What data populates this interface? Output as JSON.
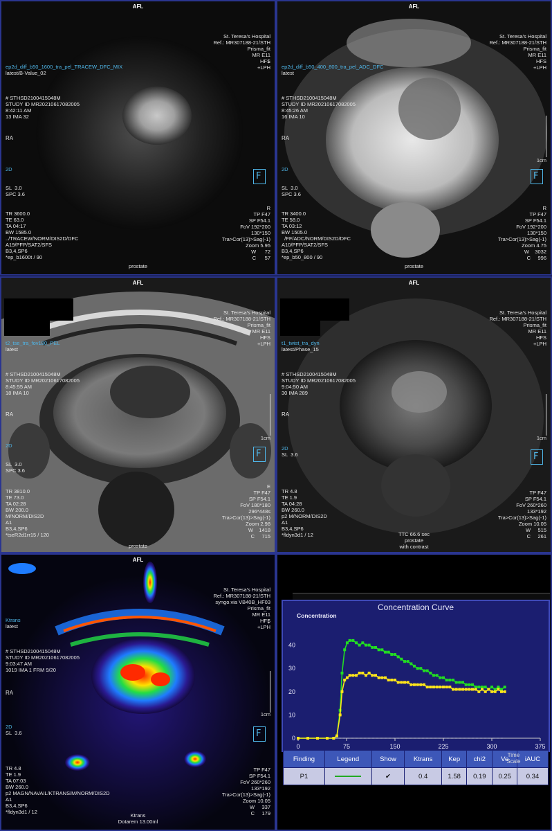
{
  "common": {
    "afl": "AFL",
    "ra": "RA",
    "cm": "1cm",
    "hospital": [
      "St. Teresa's Hospital",
      "Ref.: MR307188-21/STH",
      "Prisma_fit",
      "MR E11",
      "HFS",
      "+LPH"
    ]
  },
  "panels": [
    {
      "id": "p1",
      "series": "ep2d_diff_b50_1600_tra_pel_TRACEW_DFC_MIX",
      "sub": "latest/B-Value_02",
      "study": [
        "# STHSD2100415048M",
        "STUDY ID MR20210617082005",
        "8:42:11 AM",
        "13 IMA 32"
      ],
      "slice": [
        "2D",
        "SL  3.0",
        "SPC 3.6"
      ],
      "params": [
        "TR 3600.0",
        "TE 63.0",
        "TA 04:17",
        "BW 1585.0",
        "../TRACEW/NORM/DIS2D/DFC",
        "",
        "A19/PFP/SAT2/SFS",
        "B3,4,SP6",
        "*ep_b1600t / 90"
      ],
      "right": [
        "R",
        "TP F47",
        "SP F54.1",
        "FoV 192*200",
        "130*150",
        "Tra>Cor(13)>Sag(-1)",
        "Zoom 5.95",
        "W      72",
        "C      57"
      ],
      "bottom": [
        "prostate"
      ]
    },
    {
      "id": "p2",
      "series": "ep2d_diff_b50_400_800_tra_pel_ADC_DFC",
      "sub": "latest",
      "study": [
        "# STHSD2100415048M",
        "STUDY ID MR20210617082005",
        "8:45:26 AM",
        "16 IMA 10"
      ],
      "slice": [
        "2D",
        "SL  3.0",
        "SPC 3.6"
      ],
      "params": [
        "TR 3400.0",
        "TE 58.0",
        "TA 03:12",
        "BW 1505.0",
        "  /FF/ADC/NORM/DIS2D/DFC",
        "",
        "A10/PFP/SAT2/SFS",
        "B3,4,SP6",
        "*ep_b50_800 / 90"
      ],
      "right": [
        "R",
        "TP F47",
        "SP F54.1",
        "FoV 192*200",
        "130*150",
        "Tra>Cor(13)>Sag(-1)",
        "Zoom 4.75",
        "W    3032",
        "C     996"
      ],
      "bottom": [
        "prostate"
      ]
    },
    {
      "id": "p3",
      "series": "t2_tse_tra_fov180_PEL",
      "sub": "latest",
      "study": [
        "# STHSD2100415048M",
        "STUDY ID MR20210617082005",
        "8:45:55 AM",
        "18 IMA 10"
      ],
      "slice": [
        "2D",
        "SL  3.0",
        "SPC 3.6"
      ],
      "params": [
        "TR 3810.0",
        "TE 73.0",
        "TA 02:28",
        "BW 200.0",
        "M/NORM/DIS2D",
        "",
        "A1",
        "B3,4,SP6",
        "*tseR2d1rr15 / 120"
      ],
      "right": [
        "E",
        "TP F47",
        "SP F54.1",
        "FoV 180*180",
        "296*448s",
        "Tra>Cor(13)>Sag(-1)",
        "Zoom 2.98",
        "W    1418",
        "C     715"
      ],
      "bottom": [
        "prostate"
      ]
    },
    {
      "id": "p4",
      "series": "t1_twist_tra_dyn",
      "sub": "latest/Phase_15",
      "study": [
        "# STHSD2100415048M",
        "STUDY ID MR20210617082005",
        "9:04:50 AM",
        "30 IMA 289"
      ],
      "slice": [
        "2D",
        "SL  3.6"
      ],
      "params": [
        "TR 4.8",
        "TE 1.9",
        "TA 04:28",
        "BW 260.0",
        "p2 M/NORM/DIS2D",
        "",
        "A1",
        "B3,4,SP6",
        "*fldyn3d1 / 12"
      ],
      "right": [
        "TP F47",
        "SP F54.1",
        "FoV 260*260",
        "133*192",
        "Tra>Cor(13)>Sag(-1)",
        "Zoom 10.05",
        "W     515",
        "C     261"
      ],
      "bottom": [
        "TTC 66.6 sec",
        "prostate",
        "with contrast"
      ]
    },
    {
      "id": "p5",
      "series": "Ktrans",
      "sub": "latest",
      "study": [
        "# STHSD2100415048M",
        "STUDY ID MR20210617082005",
        "9:03:47 AM",
        "1019 IMA 1 FRM 9/20"
      ],
      "slice": [
        "2D",
        "SL  3.6"
      ],
      "params": [
        "TR 4.8",
        "TE 1.9",
        "TA 07:03",
        "BW 260.0",
        "p2 MAGN/NAVAIL/KTRANS/M/NORM/DIS2D",
        "",
        "A1",
        "B3,4,SP6",
        "*fldyn3d1 / 12"
      ],
      "right": [
        "TP F47",
        "SP F54.1",
        "FoV 260*260",
        "133*192",
        "Tra>Cor(13)>Sag(-1)",
        "Zoom 10.05",
        "W     337",
        "C     179"
      ],
      "bottom": [
        "Ktrans",
        "Dotarem 13.00ml"
      ],
      "extra": "syngo.via VB40B_HF03"
    }
  ],
  "chart_data": {
    "type": "line",
    "title": "Concentration Curve",
    "ylabel": "Concentration",
    "xlabel": "",
    "xlim": [
      0,
      375
    ],
    "ylim": [
      0,
      50
    ],
    "x_ticks": [
      0,
      75,
      150,
      225,
      300,
      375
    ],
    "y_ticks": [
      0,
      10,
      20,
      30,
      40
    ],
    "y_tick_labels": [
      "0",
      "10",
      "20",
      "30",
      "40"
    ],
    "colors": {
      "green": "#22dd22",
      "yellow": "#ffe61a",
      "baseline": "#dddddd"
    },
    "series": [
      {
        "color": "green",
        "x": [
          0,
          15,
          30,
          45,
          55,
          60,
          65,
          68,
          72,
          76,
          80,
          85,
          90,
          95,
          100,
          105,
          110,
          115,
          120,
          125,
          130,
          135,
          140,
          145,
          150,
          155,
          160,
          165,
          170,
          175,
          180,
          185,
          190,
          195,
          200,
          205,
          210,
          215,
          220,
          225,
          230,
          235,
          240,
          245,
          250,
          255,
          260,
          265,
          270,
          275,
          280,
          285,
          290,
          295,
          300,
          305,
          310,
          315,
          320
        ],
        "y": [
          0,
          0,
          0,
          0,
          0,
          1,
          12,
          28,
          38,
          41,
          42,
          42,
          41,
          40,
          41,
          40,
          40,
          39,
          39,
          38,
          38,
          37,
          37,
          36,
          36,
          35,
          34,
          33,
          33,
          32,
          31,
          30,
          30,
          29,
          29,
          28,
          27,
          27,
          26,
          26,
          25,
          25,
          25,
          24,
          24,
          24,
          23,
          23,
          23,
          22,
          22,
          22,
          22,
          21,
          22,
          21,
          22,
          21,
          22
        ]
      },
      {
        "color": "yellow",
        "x": [
          0,
          15,
          30,
          45,
          55,
          60,
          65,
          68,
          72,
          76,
          80,
          85,
          90,
          95,
          100,
          105,
          110,
          115,
          120,
          125,
          130,
          135,
          140,
          145,
          150,
          155,
          160,
          165,
          170,
          175,
          180,
          185,
          190,
          195,
          200,
          205,
          210,
          215,
          220,
          225,
          230,
          235,
          240,
          245,
          250,
          255,
          260,
          265,
          270,
          275,
          280,
          285,
          290,
          295,
          300,
          305,
          310,
          315,
          320
        ],
        "y": [
          0,
          0,
          0,
          0,
          0,
          1,
          10,
          20,
          25,
          26,
          27,
          27,
          27,
          28,
          28,
          27,
          28,
          27,
          27,
          26,
          26,
          26,
          25,
          25,
          25,
          24,
          24,
          24,
          24,
          23,
          23,
          23,
          23,
          23,
          22,
          22,
          22,
          22,
          22,
          22,
          22,
          22,
          21,
          21,
          21,
          21,
          21,
          21,
          21,
          21,
          20,
          21,
          20,
          21,
          20,
          20,
          21,
          20,
          20
        ]
      }
    ]
  },
  "table": {
    "headers": [
      "Finding",
      "Legend",
      "Show",
      "Ktrans",
      "Kep",
      "chi2",
      "Ve",
      "iAUC"
    ],
    "header_extra": "Time Scale",
    "rows": [
      {
        "finding": "P1",
        "show": "✔",
        "ktrans": "0.4",
        "kep": "1.58",
        "chi2": "0.19",
        "ve": "0.25",
        "iauc": "0.34"
      }
    ]
  }
}
